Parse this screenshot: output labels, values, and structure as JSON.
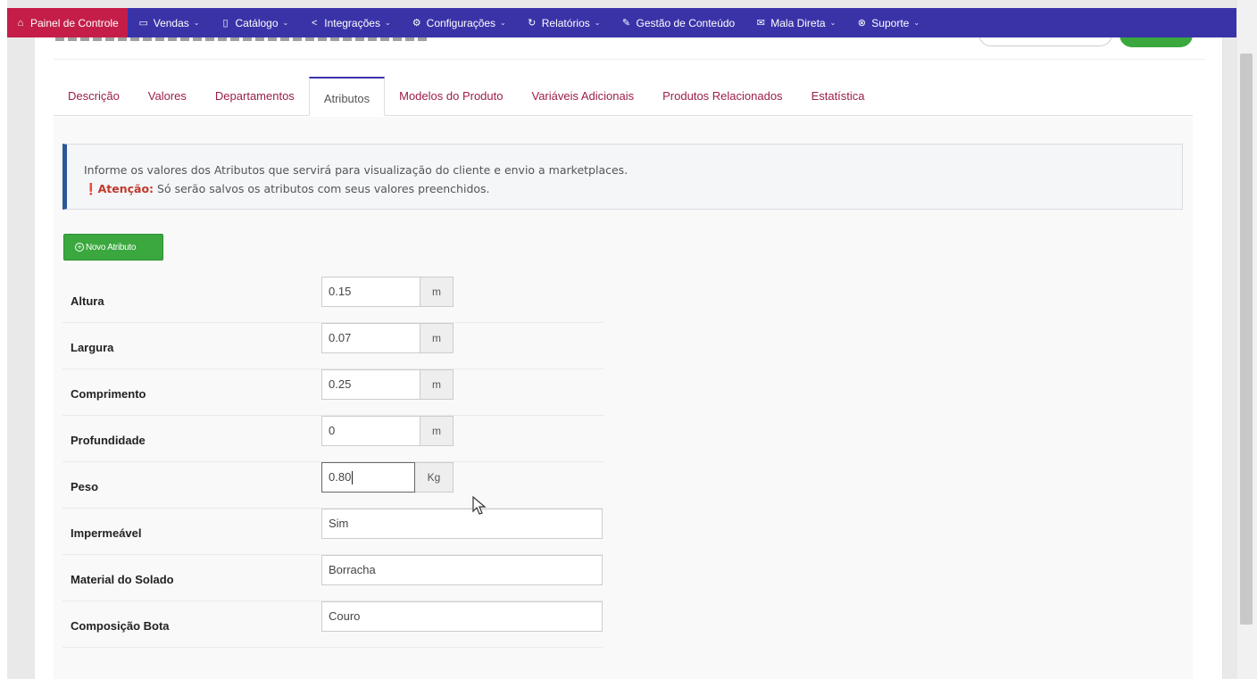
{
  "nav": {
    "items": [
      {
        "label": "Painel de Controle",
        "icon": "home-icon",
        "glyph": "⌂",
        "dropdown": false
      },
      {
        "label": "Vendas",
        "icon": "inbox-icon",
        "glyph": "▭",
        "dropdown": true
      },
      {
        "label": "Catálogo",
        "icon": "book-icon",
        "glyph": "▯",
        "dropdown": true
      },
      {
        "label": "Integrações",
        "icon": "share-icon",
        "glyph": "<",
        "dropdown": true
      },
      {
        "label": "Configurações",
        "icon": "gear-icon",
        "glyph": "⚙",
        "dropdown": true
      },
      {
        "label": "Relatórios",
        "icon": "history-icon",
        "glyph": "↻",
        "dropdown": true
      },
      {
        "label": "Gestão de Conteúdo",
        "icon": "edit-icon",
        "glyph": "✎",
        "dropdown": false
      },
      {
        "label": "Mala Direta",
        "icon": "envelope-icon",
        "glyph": "✉",
        "dropdown": true
      },
      {
        "label": "Suporte",
        "icon": "support-icon",
        "glyph": "⊗",
        "dropdown": true
      }
    ]
  },
  "tabs": [
    "Descrição",
    "Valores",
    "Departamentos",
    "Atributos",
    "Modelos do Produto",
    "Variáveis Adicionais",
    "Produtos Relacionados",
    "Estatística"
  ],
  "active_tab": "Atributos",
  "callout": {
    "line1": "Informe os valores dos Atributos que servirá para visualização do cliente e envio a marketplaces.",
    "warn_label": "Atenção:",
    "line2": "Só serão salvos os atributos com seus valores preenchidos."
  },
  "new_button": {
    "label": "Novo Atributo"
  },
  "attributes": [
    {
      "label": "Altura",
      "value": "0.15",
      "unit": "m"
    },
    {
      "label": "Largura",
      "value": "0.07",
      "unit": "m"
    },
    {
      "label": "Comprimento",
      "value": "0.25",
      "unit": "m"
    },
    {
      "label": "Profundidade",
      "value": "0",
      "unit": "m"
    },
    {
      "label": "Peso",
      "value": "0.80",
      "unit": "Kg",
      "focused": true
    },
    {
      "label": "Impermeável",
      "value": "Sim"
    },
    {
      "label": "Material do Solado",
      "value": "Borracha"
    },
    {
      "label": "Composição Bota",
      "value": "Couro"
    }
  ],
  "colors": {
    "nav_bg": "#3a33a8",
    "home_bg": "#c41e48",
    "tab_text": "#9c1e4a",
    "green": "#3aa83e",
    "callout_border": "#2b5797"
  }
}
